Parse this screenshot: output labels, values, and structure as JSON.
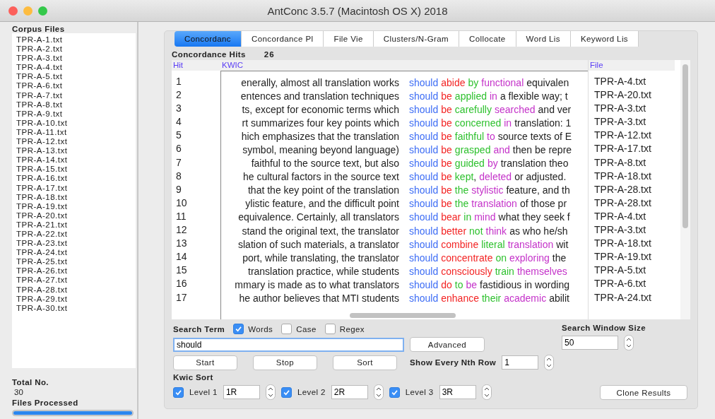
{
  "window": {
    "title": "AntConc 3.5.7 (Macintosh OS X) 2018"
  },
  "corpus_files": {
    "title": "Corpus Files",
    "items": [
      "TPR-A-1.txt",
      "TPR-A-2.txt",
      "TPR-A-3.txt",
      "TPR-A-4.txt",
      "TPR-A-5.txt",
      "TPR-A-6.txt",
      "TPR-A-7.txt",
      "TPR-A-8.txt",
      "TPR-A-9.txt",
      "TPR-A-10.txt",
      "TPR-A-11.txt",
      "TPR-A-12.txt",
      "TPR-A-13.txt",
      "TPR-A-14.txt",
      "TPR-A-15.txt",
      "TPR-A-16.txt",
      "TPR-A-17.txt",
      "TPR-A-18.txt",
      "TPR-A-19.txt",
      "TPR-A-20.txt",
      "TPR-A-21.txt",
      "TPR-A-22.txt",
      "TPR-A-23.txt",
      "TPR-A-24.txt",
      "TPR-A-25.txt",
      "TPR-A-26.txt",
      "TPR-A-27.txt",
      "TPR-A-28.txt",
      "TPR-A-29.txt",
      "TPR-A-30.txt"
    ],
    "total_label": "Total No.",
    "total": "30",
    "processed_label": "Files Processed",
    "processed": {
      "level": 1
    }
  },
  "tabs": [
    {
      "label": "Concordanc",
      "selected": true
    },
    {
      "label": "Concordance Pl",
      "selected": false
    },
    {
      "label": "File Vie",
      "selected": false
    },
    {
      "label": "Clusters/N-Gram",
      "selected": false
    },
    {
      "label": "Collocate",
      "selected": false
    },
    {
      "label": "Word Lis",
      "selected": false
    },
    {
      "label": "Keyword Lis",
      "selected": false
    }
  ],
  "hits_label": "Concordance Hits",
  "hits": "26",
  "table": {
    "columns": [
      "Hit",
      "KWIC",
      "File"
    ],
    "rows": [
      {
        "hit": "1",
        "left": "enerally, almost all translation works",
        "tokens": [
          {
            "kind": "node",
            "text": "should"
          },
          {
            "kind": "level1",
            "text": "abide"
          },
          {
            "kind": "level2",
            "text": "by"
          },
          {
            "kind": "level3",
            "text": "functional"
          },
          {
            "kind": "plain",
            "text": "equivalen"
          }
        ],
        "file": "TPR-A-4.txt"
      },
      {
        "hit": "2",
        "left": "entences and translation techniques",
        "tokens": [
          {
            "kind": "node",
            "text": "should"
          },
          {
            "kind": "level1",
            "text": "be"
          },
          {
            "kind": "level2",
            "text": "applied"
          },
          {
            "kind": "level3",
            "text": "in"
          },
          {
            "kind": "plain",
            "text": "a flexible way; t"
          }
        ],
        "file": "TPR-A-20.txt"
      },
      {
        "hit": "3",
        "left": "ts, except for economic terms which",
        "tokens": [
          {
            "kind": "node",
            "text": "should"
          },
          {
            "kind": "level1",
            "text": "be"
          },
          {
            "kind": "level2",
            "text": "carefully"
          },
          {
            "kind": "level3",
            "text": "searched"
          },
          {
            "kind": "plain",
            "text": "and ver"
          }
        ],
        "file": "TPR-A-3.txt"
      },
      {
        "hit": "4",
        "left": "rt summarizes four key points which",
        "tokens": [
          {
            "kind": "node",
            "text": "should"
          },
          {
            "kind": "level1",
            "text": "be"
          },
          {
            "kind": "level2",
            "text": "concerned"
          },
          {
            "kind": "level3",
            "text": "in"
          },
          {
            "kind": "plain",
            "text": "translation: 1"
          }
        ],
        "file": "TPR-A-3.txt"
      },
      {
        "hit": "5",
        "left": "hich emphasizes that the translation",
        "tokens": [
          {
            "kind": "node",
            "text": "should"
          },
          {
            "kind": "level1",
            "text": "be"
          },
          {
            "kind": "level2",
            "text": "faithful"
          },
          {
            "kind": "level3",
            "text": "to"
          },
          {
            "kind": "plain",
            "text": "source texts of E"
          }
        ],
        "file": "TPR-A-12.txt"
      },
      {
        "hit": "6",
        "left": "symbol, meaning beyond language)",
        "tokens": [
          {
            "kind": "node",
            "text": "should"
          },
          {
            "kind": "level1",
            "text": "be"
          },
          {
            "kind": "level2",
            "text": "grasped"
          },
          {
            "kind": "level3",
            "text": "and"
          },
          {
            "kind": "plain",
            "text": "then be repre"
          }
        ],
        "file": "TPR-A-17.txt"
      },
      {
        "hit": "7",
        "left": "faithful to the source text, but also",
        "tokens": [
          {
            "kind": "node",
            "text": "should"
          },
          {
            "kind": "level1",
            "text": "be"
          },
          {
            "kind": "level2",
            "text": "guided"
          },
          {
            "kind": "level3",
            "text": "by"
          },
          {
            "kind": "plain",
            "text": "translation theo"
          }
        ],
        "file": "TPR-A-8.txt"
      },
      {
        "hit": "8",
        "left": "he cultural factors in the source text",
        "tokens": [
          {
            "kind": "node",
            "text": "should"
          },
          {
            "kind": "level1",
            "text": "be"
          },
          {
            "kind": "level2",
            "text": "kept"
          },
          {
            "kind": "punct",
            "text": ","
          },
          {
            "kind": "level3",
            "text": "deleted"
          },
          {
            "kind": "plain",
            "text": "or adjusted."
          }
        ],
        "file": "TPR-A-18.txt"
      },
      {
        "hit": "9",
        "left": "that the key point of the translation",
        "tokens": [
          {
            "kind": "node",
            "text": "should"
          },
          {
            "kind": "level1",
            "text": "be"
          },
          {
            "kind": "level2",
            "text": "the"
          },
          {
            "kind": "level3",
            "text": "stylistic"
          },
          {
            "kind": "plain",
            "text": "feature, and th"
          }
        ],
        "file": "TPR-A-28.txt"
      },
      {
        "hit": "10",
        "left": "ylistic feature, and the difficult point",
        "tokens": [
          {
            "kind": "node",
            "text": "should"
          },
          {
            "kind": "level1",
            "text": "be"
          },
          {
            "kind": "level2",
            "text": "the"
          },
          {
            "kind": "level3",
            "text": "translation"
          },
          {
            "kind": "plain",
            "text": "of those pr"
          }
        ],
        "file": "TPR-A-28.txt"
      },
      {
        "hit": "11",
        "left": "equivalence. Certainly, all translators",
        "tokens": [
          {
            "kind": "node",
            "text": "should"
          },
          {
            "kind": "level1",
            "text": "bear"
          },
          {
            "kind": "level2",
            "text": "in"
          },
          {
            "kind": "level3",
            "text": "mind"
          },
          {
            "kind": "plain",
            "text": "what they seek f"
          }
        ],
        "file": "TPR-A-4.txt"
      },
      {
        "hit": "12",
        "left": "stand the original text, the translator",
        "tokens": [
          {
            "kind": "node",
            "text": "should"
          },
          {
            "kind": "level1",
            "text": "better"
          },
          {
            "kind": "level2",
            "text": "not"
          },
          {
            "kind": "level3",
            "text": "think"
          },
          {
            "kind": "plain",
            "text": "as who he/sh"
          }
        ],
        "file": "TPR-A-3.txt"
      },
      {
        "hit": "13",
        "left": "slation of such materials, a translator",
        "tokens": [
          {
            "kind": "node",
            "text": "should"
          },
          {
            "kind": "level1",
            "text": "combine"
          },
          {
            "kind": "level2",
            "text": "literal"
          },
          {
            "kind": "level3",
            "text": "translation"
          },
          {
            "kind": "plain",
            "text": "wit"
          }
        ],
        "file": "TPR-A-18.txt"
      },
      {
        "hit": "14",
        "left": "port, while translating, the translator",
        "tokens": [
          {
            "kind": "node",
            "text": "should"
          },
          {
            "kind": "level1",
            "text": "concentrate"
          },
          {
            "kind": "level2",
            "text": "on"
          },
          {
            "kind": "level3",
            "text": "exploring"
          },
          {
            "kind": "plain",
            "text": "the"
          }
        ],
        "file": "TPR-A-19.txt"
      },
      {
        "hit": "15",
        "left": "translation practice, while students",
        "tokens": [
          {
            "kind": "node",
            "text": "should"
          },
          {
            "kind": "level1",
            "text": "consciously"
          },
          {
            "kind": "level2",
            "text": "train"
          },
          {
            "kind": "level3",
            "text": "themselves"
          }
        ],
        "file": "TPR-A-5.txt"
      },
      {
        "hit": "16",
        "left": "mmary is made as to what translators",
        "tokens": [
          {
            "kind": "node",
            "text": "should"
          },
          {
            "kind": "level1",
            "text": "do"
          },
          {
            "kind": "level2",
            "text": "to"
          },
          {
            "kind": "level3",
            "text": "be"
          },
          {
            "kind": "plain",
            "text": "fastidious in wording"
          }
        ],
        "file": "TPR-A-6.txt"
      },
      {
        "hit": "17",
        "left": "he author believes that MTI students",
        "tokens": [
          {
            "kind": "node",
            "text": "should"
          },
          {
            "kind": "level1",
            "text": "enhance"
          },
          {
            "kind": "level2",
            "text": "their"
          },
          {
            "kind": "level3",
            "text": "academic"
          },
          {
            "kind": "plain",
            "text": "abilit"
          }
        ],
        "file": "TPR-A-24.txt"
      }
    ]
  },
  "search": {
    "label": "Search Term",
    "options": [
      {
        "label": "Words",
        "checked": true
      },
      {
        "label": "Case",
        "checked": false
      },
      {
        "label": "Regex",
        "checked": false
      }
    ],
    "value": "should",
    "advanced": "Advanced"
  },
  "window_size": {
    "label": "Search Window Size",
    "value": "50"
  },
  "actions": [
    "Start",
    "Stop",
    "Sort"
  ],
  "nth_row": {
    "label": "Show Every Nth Row",
    "value": "1"
  },
  "kwic_sort": {
    "label": "Kwic Sort",
    "levels": [
      {
        "label": "Level 1",
        "checked": true,
        "value": "1R"
      },
      {
        "label": "Level 2",
        "checked": true,
        "value": "2R"
      },
      {
        "label": "Level 3",
        "checked": true,
        "value": "3R"
      }
    ]
  },
  "clone": "Clone Results"
}
